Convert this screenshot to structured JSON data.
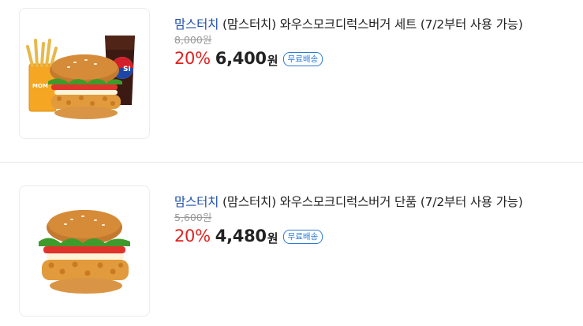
{
  "products": [
    {
      "brand": "맘스터치",
      "name": "(맘스터치) 와우스모크디럭스버거 세트 (7/2부터 사용 가능)",
      "original_price": "8,000원",
      "discount": "20%",
      "price": "6,400",
      "currency": "원",
      "shipping_badge": "무료배송",
      "image": "burger-set-photo",
      "image_text": "MOM",
      "cup_logo_text": "SI"
    },
    {
      "brand": "맘스터치",
      "name": "(맘스터치) 와우스모크디럭스버거 단품 (7/2부터 사용 가능)",
      "original_price": "5,600원",
      "discount": "20%",
      "price": "4,480",
      "currency": "원",
      "shipping_badge": "무료배송",
      "image": "burger-single-photo"
    }
  ],
  "colors": {
    "brand": "#1f4fa8",
    "discount": "#e02020",
    "badge": "#2a7bd8"
  }
}
